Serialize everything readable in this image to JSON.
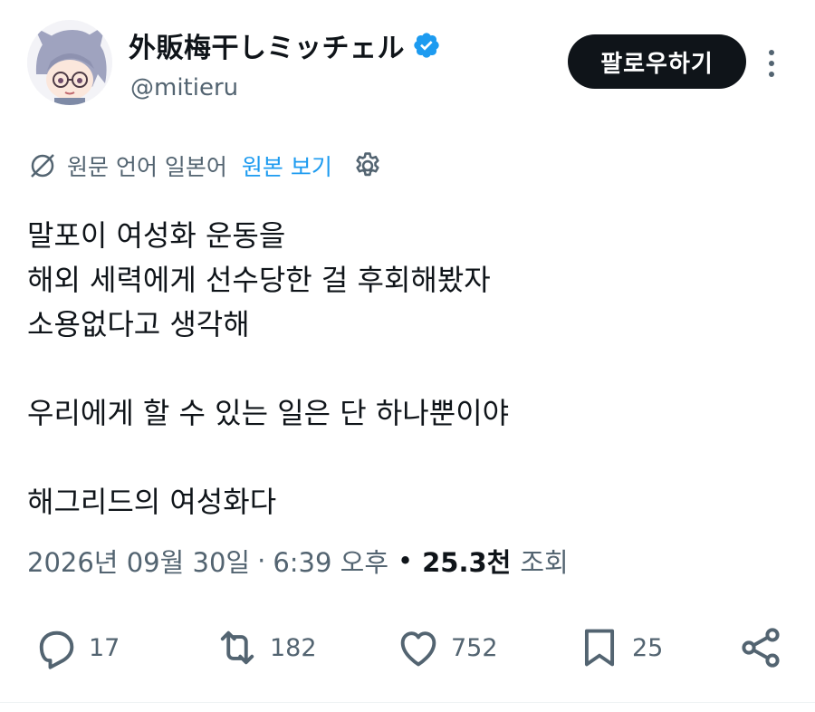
{
  "author": {
    "display_name": "外販梅干しミッチェル",
    "handle": "@mitieru",
    "verified_icon": "verified-badge-icon",
    "avatar": "avatar"
  },
  "follow_button": {
    "label": "팔로우하기"
  },
  "more_icon": "more-vertical-icon",
  "translation": {
    "original_language_label": "원문 언어 일본어",
    "show_original_label": "원본 보기",
    "translate_icon": "translate-icon",
    "settings_icon": "gear-icon"
  },
  "post": {
    "lines": [
      "말포이 여성화 운동을",
      "해외 세력에게 선수당한 걸 후회해봤자",
      "소용없다고 생각해",
      "",
      "우리에게 할 수 있는 일은 단 하나뿐이야",
      "",
      "해그리드의 여성화다"
    ]
  },
  "meta": {
    "date": "2026년 09월 30일",
    "separator": "·",
    "time": "6:39 오후",
    "bullet": "•",
    "views_count": "25.3천",
    "views_label": "조회"
  },
  "actions": {
    "reply": {
      "icon": "reply-icon",
      "count": "17"
    },
    "repost": {
      "icon": "repost-icon",
      "count": "182"
    },
    "like": {
      "icon": "heart-icon",
      "count": "752"
    },
    "bookmark": {
      "icon": "bookmark-icon",
      "count": "25"
    },
    "share": {
      "icon": "share-icon"
    }
  },
  "colors": {
    "text_primary": "#0f1419",
    "text_secondary": "#536471",
    "accent_blue": "#1d9bf0",
    "button_bg": "#0f1419",
    "button_text": "#ffffff"
  }
}
